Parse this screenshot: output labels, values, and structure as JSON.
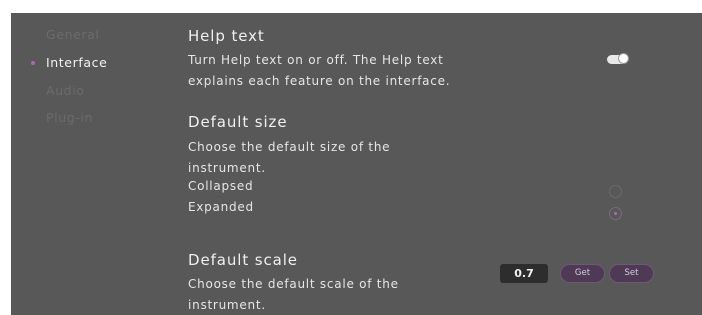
{
  "sidebar": {
    "items": [
      {
        "label": "General",
        "active": false
      },
      {
        "label": "Interface",
        "active": true
      },
      {
        "label": "Audio",
        "active": false
      },
      {
        "label": "Plug-in",
        "active": false
      }
    ]
  },
  "help_text": {
    "title": "Help text",
    "description": "Turn Help text on or off. The Help text explains each feature on the interface.",
    "enabled": true
  },
  "default_size": {
    "title": "Default size",
    "description": "Choose the default size of the instrument.",
    "options": [
      {
        "label": "Collapsed",
        "selected": false
      },
      {
        "label": "Expanded",
        "selected": true
      }
    ]
  },
  "default_scale": {
    "title": "Default scale",
    "description": "Choose the default scale of the instrument.",
    "value": "0.7",
    "get_label": "Get",
    "set_label": "Set"
  },
  "colors": {
    "background": "#585858",
    "accent": "#b362b9",
    "button_fill": "#4f3a55",
    "value_box": "#2d2d2d"
  },
  "icons": {
    "toggle": "toggle-switch",
    "active_indicator": "dot"
  }
}
